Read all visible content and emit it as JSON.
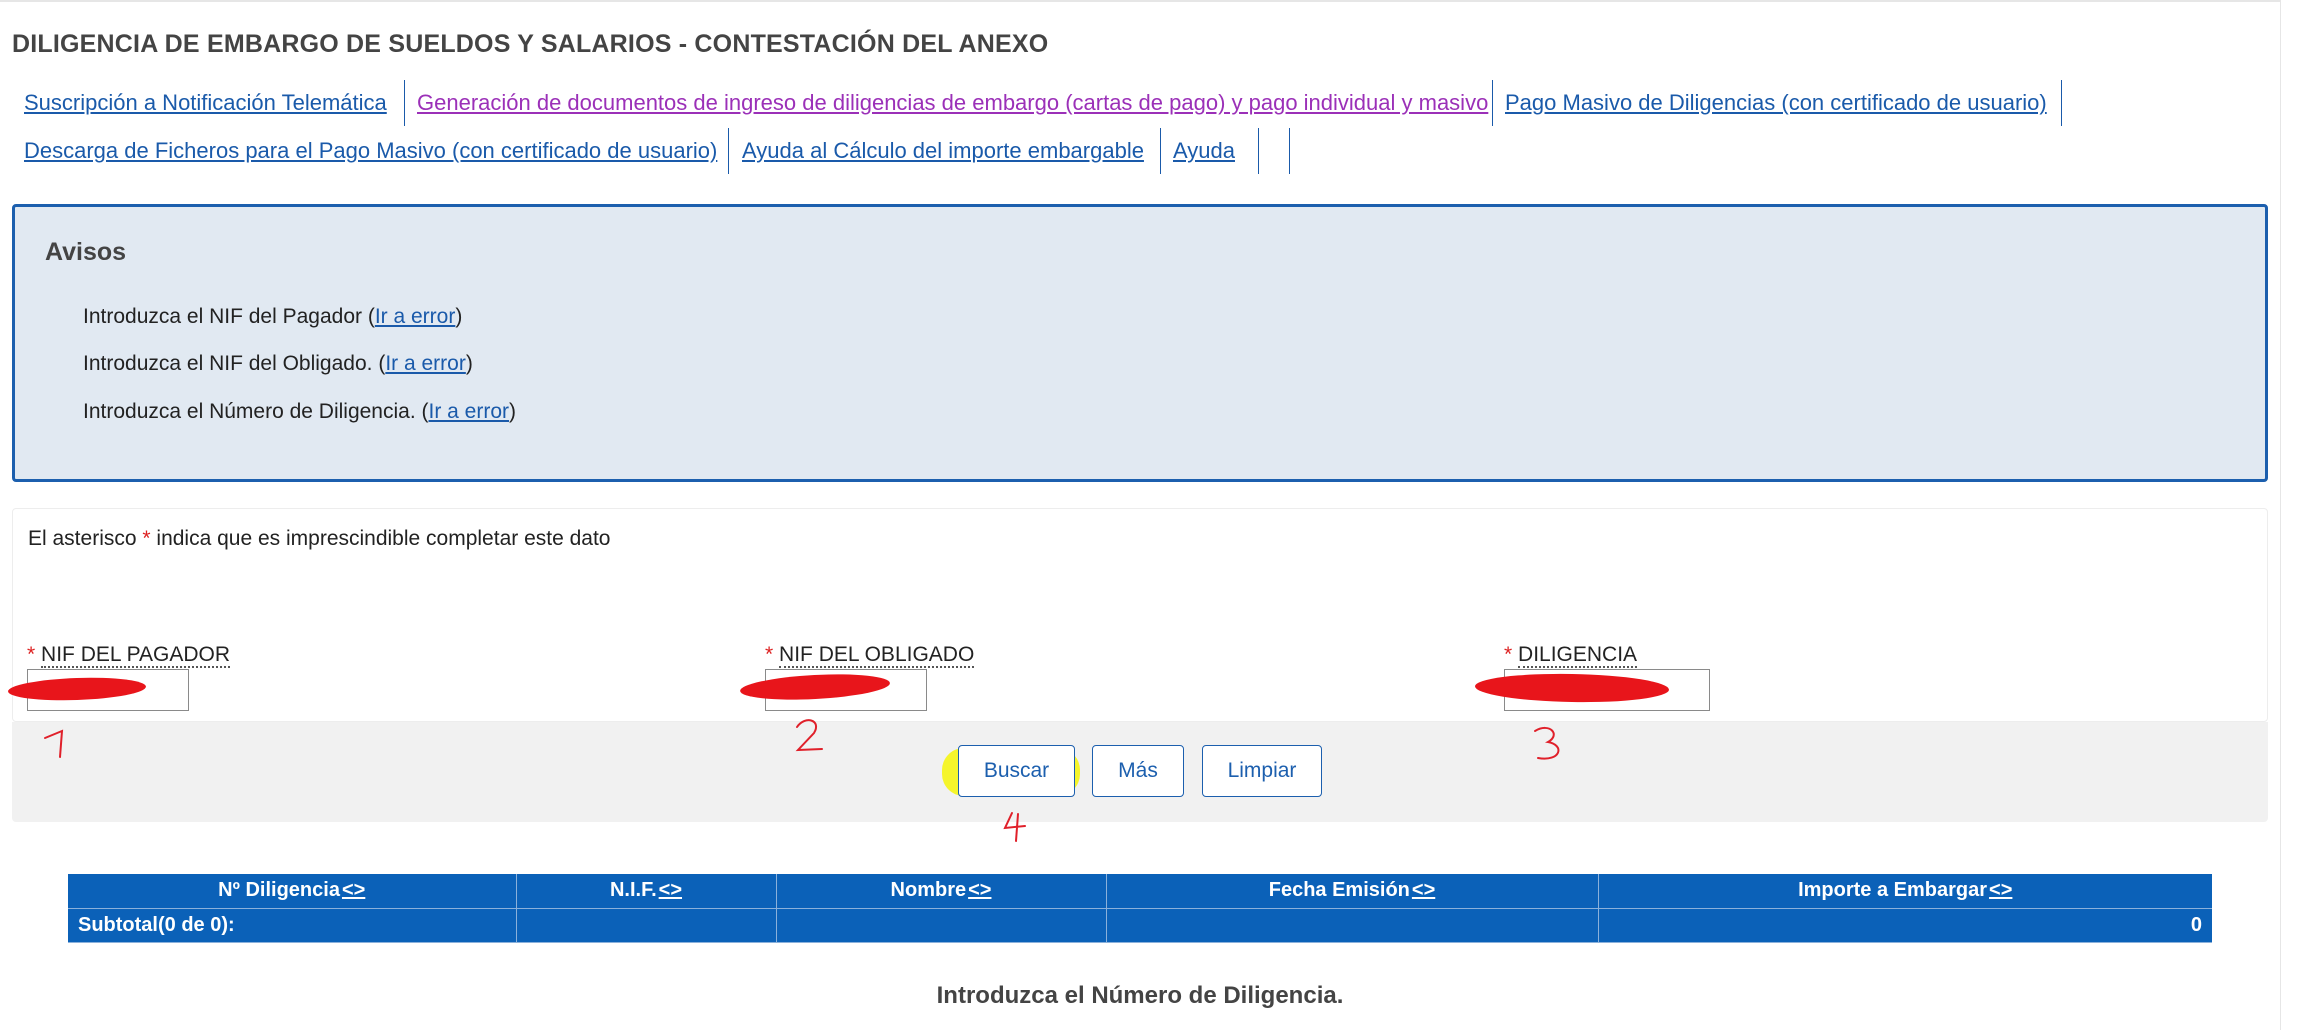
{
  "page": {
    "title": "DILIGENCIA DE EMBARGO DE SUELDOS Y SALARIOS - CONTESTACIÓN DEL ANEXO"
  },
  "nav": {
    "row1": [
      "Suscripción a Notificación Telemática",
      "Generación de documentos de ingreso de diligencias de embargo (cartas de pago) y pago individual y masivo",
      "Pago Masivo de Diligencias (con certificado de usuario)"
    ],
    "row2": [
      "Descarga de Ficheros para el Pago Masivo (con certificado de usuario)",
      "Ayuda al Cálculo del importe embargable",
      "Ayuda"
    ]
  },
  "avisos": {
    "title": "Avisos",
    "link_text": "Ir a error",
    "items": [
      {
        "text": "Introduzca el NIF del Pagador (",
        "close": ")"
      },
      {
        "text": "Introduzca el NIF del Obligado. (",
        "close": ")"
      },
      {
        "text": "Introduzca el Número de Diligencia. (",
        "close": ")"
      }
    ]
  },
  "form": {
    "note_before": "El asterisco ",
    "required_mark": "*",
    "note_after": " indica que es imprescindible completar este dato",
    "fields": [
      {
        "label": "NIF DEL PAGADOR"
      },
      {
        "label": "NIF DEL OBLIGADO"
      },
      {
        "label": "DILIGENCIA"
      }
    ]
  },
  "buttons": {
    "search": "Buscar",
    "more": "Más",
    "clear": "Limpiar"
  },
  "annotations": {
    "n1": "1",
    "n2": "2",
    "n3": "3",
    "n4": "4",
    "ink_color": "#e0202a",
    "highlight_color": "#f5f51a"
  },
  "table": {
    "sort_marker": "<>",
    "columns": [
      "Nº Diligencia",
      "N.I.F.",
      "Nombre",
      "Fecha Emisión",
      "Importe a Embargar"
    ],
    "subtotal_label": "Subtotal(0 de 0):",
    "subtotal_value": "0"
  },
  "status": {
    "message": "Introduzca el Número de Diligencia."
  },
  "colors": {
    "link": "#1a5aaa",
    "link_visited": "#9b30b8",
    "panel_border": "#1c5fae",
    "panel_bg": "#e1e9f2",
    "table_bg": "#0b61b8"
  }
}
